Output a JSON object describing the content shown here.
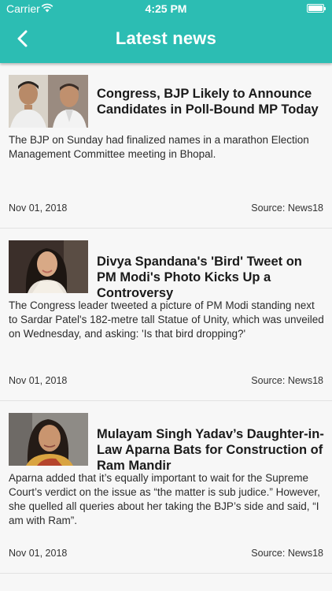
{
  "status": {
    "carrier": "Carrier",
    "time": "4:25 PM"
  },
  "header": {
    "title": "Latest news"
  },
  "articles": [
    {
      "title": "Congress, BJP Likely to Announce Candidates in Poll-Bound MP Today",
      "summary": "The BJP on Sunday had finalized names in a marathon Election Management Committee meeting in Bhopal.",
      "date": "Nov 01, 2018",
      "source": "Source: News18"
    },
    {
      "title": "Divya Spandana's 'Bird' Tweet on PM Modi's Photo Kicks Up a Controversy",
      "summary": "The Congress leader tweeted a picture of PM Modi standing next to Sardar Patel's 182-metre tall Statue of Unity, which was unveiled on Wednesday, and asking: 'Is that bird dropping?'",
      "date": "Nov 01, 2018",
      "source": "Source: News18"
    },
    {
      "title": "Mulayam Singh Yadav’s Daughter-in-Law Aparna Bats for Construction of Ram Mandir",
      "summary": "Aparna added that it’s equally important to wait for the Supreme Court’s verdict on the issue as “the matter is sub judice.” However, she quelled all queries about her taking the BJP’s side and said, “I am with Ram”.",
      "date": "Nov 01, 2018",
      "source": "Source: News18"
    }
  ]
}
